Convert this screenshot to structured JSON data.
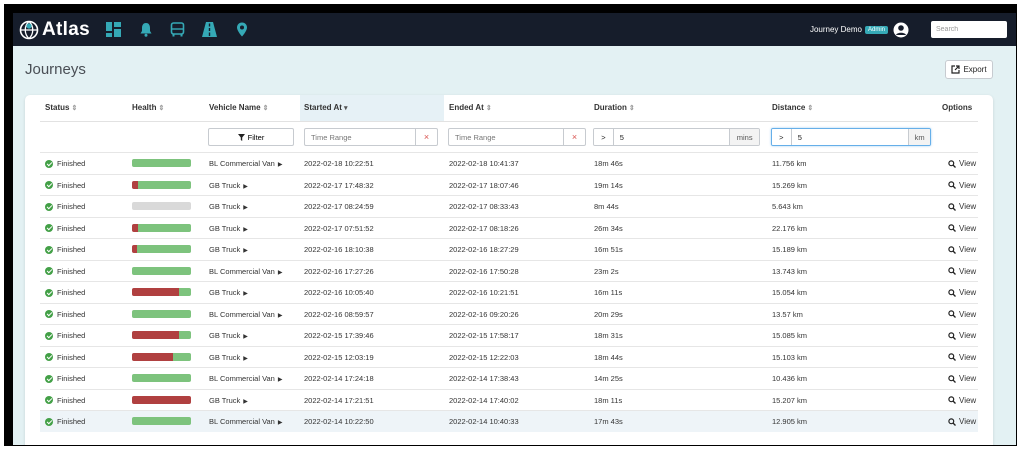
{
  "app": {
    "name": "Atlas",
    "colors": {
      "topbar": "#161d2b",
      "accent": "#35a9b6",
      "good": "#7dc37d",
      "bad": "#b04040",
      "ok": "#43a047"
    }
  },
  "nav": {
    "icons": [
      "dashboard-icon",
      "bell-icon",
      "bus-icon",
      "road-icon",
      "map-pin-icon"
    ]
  },
  "user": {
    "name": "Journey Demo",
    "role": "Admin"
  },
  "search": {
    "placeholder": "Search"
  },
  "page": {
    "title": "Journeys",
    "export_label": "Export"
  },
  "table": {
    "columns": {
      "status": "Status",
      "health": "Health",
      "vehicle": "Vehicle Name",
      "started": "Started At",
      "ended": "Ended At",
      "duration": "Duration",
      "distance": "Distance",
      "options": "Options"
    },
    "filters": {
      "filter_label": "Filter",
      "started_placeholder": "Time Range",
      "ended_placeholder": "Time Range",
      "duration_op": ">",
      "duration_value": "5",
      "duration_unit": "mins",
      "distance_op": ">",
      "distance_value": "5",
      "distance_unit": "km",
      "clear": "×"
    },
    "view_label": "View",
    "rows": [
      {
        "status": "Finished",
        "health_bad": 0.0,
        "health_good": 1.0,
        "vehicle": "BL Commercial Van",
        "started": "2022-02-18 10:22:51",
        "ended": "2022-02-18 10:41:37",
        "duration": "18m 46s",
        "distance": "11.756 km"
      },
      {
        "status": "Finished",
        "health_bad": 0.1,
        "health_good": 0.9,
        "vehicle": "GB Truck",
        "started": "2022-02-17 17:48:32",
        "ended": "2022-02-17 18:07:46",
        "duration": "19m 14s",
        "distance": "15.269 km"
      },
      {
        "status": "Finished",
        "health_bad": 0.0,
        "health_good": 0.0,
        "vehicle": "GB Truck",
        "started": "2022-02-17 08:24:59",
        "ended": "2022-02-17 08:33:43",
        "duration": "8m 44s",
        "distance": "5.643 km"
      },
      {
        "status": "Finished",
        "health_bad": 0.1,
        "health_good": 0.9,
        "vehicle": "GB Truck",
        "started": "2022-02-17 07:51:52",
        "ended": "2022-02-17 08:18:26",
        "duration": "26m 34s",
        "distance": "22.176 km"
      },
      {
        "status": "Finished",
        "health_bad": 0.08,
        "health_good": 0.92,
        "vehicle": "GB Truck",
        "started": "2022-02-16 18:10:38",
        "ended": "2022-02-16 18:27:29",
        "duration": "16m 51s",
        "distance": "15.189 km"
      },
      {
        "status": "Finished",
        "health_bad": 0.0,
        "health_good": 1.0,
        "vehicle": "BL Commercial Van",
        "started": "2022-02-16 17:27:26",
        "ended": "2022-02-16 17:50:28",
        "duration": "23m 2s",
        "distance": "13.743 km"
      },
      {
        "status": "Finished",
        "health_bad": 0.8,
        "health_good": 0.2,
        "vehicle": "GB Truck",
        "started": "2022-02-16 10:05:40",
        "ended": "2022-02-16 10:21:51",
        "duration": "16m 11s",
        "distance": "15.054 km"
      },
      {
        "status": "Finished",
        "health_bad": 0.0,
        "health_good": 1.0,
        "vehicle": "BL Commercial Van",
        "started": "2022-02-16 08:59:57",
        "ended": "2022-02-16 09:20:26",
        "duration": "20m 29s",
        "distance": "13.57 km"
      },
      {
        "status": "Finished",
        "health_bad": 0.8,
        "health_good": 0.2,
        "vehicle": "GB Truck",
        "started": "2022-02-15 17:39:46",
        "ended": "2022-02-15 17:58:17",
        "duration": "18m 31s",
        "distance": "15.085 km"
      },
      {
        "status": "Finished",
        "health_bad": 0.7,
        "health_good": 0.3,
        "vehicle": "GB Truck",
        "started": "2022-02-15 12:03:19",
        "ended": "2022-02-15 12:22:03",
        "duration": "18m 44s",
        "distance": "15.103 km"
      },
      {
        "status": "Finished",
        "health_bad": 0.0,
        "health_good": 1.0,
        "vehicle": "BL Commercial Van",
        "started": "2022-02-14 17:24:18",
        "ended": "2022-02-14 17:38:43",
        "duration": "14m 25s",
        "distance": "10.436 km"
      },
      {
        "status": "Finished",
        "health_bad": 1.0,
        "health_good": 0.0,
        "vehicle": "GB Truck",
        "started": "2022-02-14 17:21:51",
        "ended": "2022-02-14 17:40:02",
        "duration": "18m 11s",
        "distance": "15.207 km"
      },
      {
        "status": "Finished",
        "health_bad": 0.0,
        "health_good": 1.0,
        "vehicle": "BL Commercial Van",
        "started": "2022-02-14 10:22:50",
        "ended": "2022-02-14 10:40:33",
        "duration": "17m 43s",
        "distance": "12.905 km"
      }
    ]
  }
}
